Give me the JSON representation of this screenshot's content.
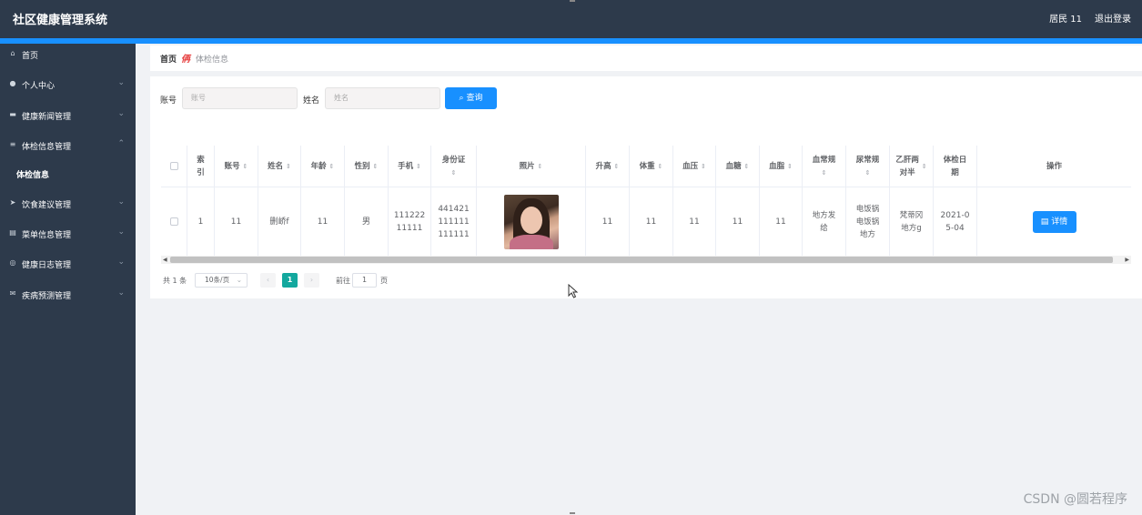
{
  "app": {
    "title": "社区健康管理系统",
    "user": "居民 11",
    "logout": "退出登录"
  },
  "sidebar": {
    "items": [
      {
        "label": "首页",
        "icon": "home-icon",
        "expand": ""
      },
      {
        "label": "个人中心",
        "icon": "user-icon",
        "expand": "⌄"
      },
      {
        "label": "健康新闻管理",
        "icon": "news-icon",
        "expand": "⌄"
      },
      {
        "label": "体检信息管理",
        "icon": "list-icon",
        "expand": "⌃"
      },
      {
        "label": "体检信息",
        "icon": "",
        "expand": ""
      },
      {
        "label": "饮食建议管理",
        "icon": "send-icon",
        "expand": "⌄"
      },
      {
        "label": "菜单信息管理",
        "icon": "menu-icon",
        "expand": "⌄"
      },
      {
        "label": "健康日志管理",
        "icon": "log-icon",
        "expand": "⌄"
      },
      {
        "label": "疾病预测管理",
        "icon": "mail-icon",
        "expand": "⌄"
      }
    ]
  },
  "breadcrumb": {
    "home": "首页",
    "separator": "侢",
    "current": "体检信息"
  },
  "search": {
    "account_label": "账号",
    "account_placeholder": "账号",
    "name_label": "姓名",
    "name_placeholder": "姓名",
    "button": "查询"
  },
  "table": {
    "headers": [
      "索\n引",
      "账号",
      "姓名",
      "年龄",
      "性别",
      "手机",
      "身份证",
      "照片",
      "升高",
      "体重",
      "血压",
      "血糖",
      "血脂",
      "血常规",
      "尿常规",
      "乙肝两\n对半",
      "体检日\n期",
      "操作"
    ],
    "rows": [
      {
        "index": "1",
        "account": "11",
        "name": "删峤f",
        "age": "11",
        "gender": "男",
        "phone": "111222\n11111",
        "id_card": "441421\n111111\n111111",
        "height": "11",
        "weight": "11",
        "blood_pressure": "11",
        "blood_sugar": "11",
        "blood_lipid": "11",
        "blood_routine": "地方发\n给",
        "urine_routine": "电饭锅\n电饭锅\n地方",
        "hepatitis_b": "梵蒂冈\n地方g",
        "date": "2021-0\n5-04",
        "action": "详情"
      }
    ]
  },
  "pagination": {
    "total": "共 1 条",
    "page_size": "10条/页",
    "current": "1",
    "goto_label": "前往",
    "goto_value": "1",
    "page_suffix": "页"
  },
  "watermark": "CSDN @圆若程序"
}
